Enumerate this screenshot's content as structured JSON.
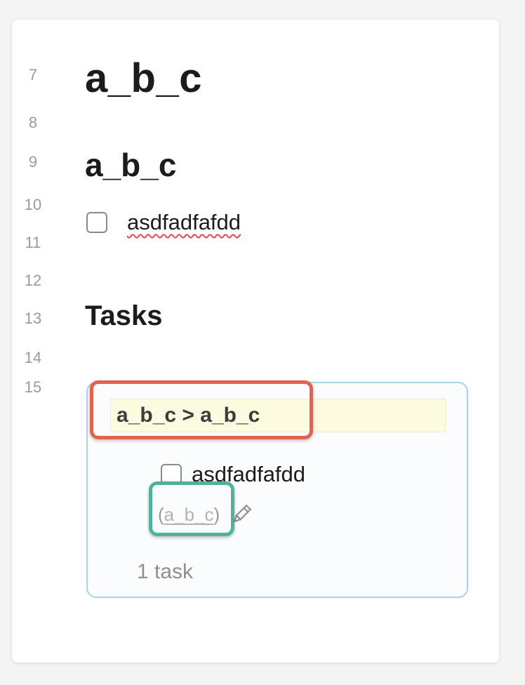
{
  "line_numbers": [
    "7",
    "8",
    "9",
    "10",
    "11",
    "12",
    "13",
    "14",
    "15"
  ],
  "heading1": "a_b_c",
  "heading2": "a_b_c",
  "task": {
    "checked": false,
    "text": "asdfadfafdd"
  },
  "heading3": "Tasks",
  "query_result": {
    "group_heading": "a_b_c > a_b_c",
    "task_text": "asdfadfafdd",
    "backlink_open": "(",
    "backlink_text": "a_b_c",
    "backlink_close": ")",
    "edit_icon": "pencil-icon",
    "task_count": "1 task"
  },
  "colors": {
    "red_highlight": "#e3624f",
    "teal_highlight": "#4fb39b",
    "query_border": "#a6d5e8",
    "group_heading_bg": "#fbfbe0"
  }
}
